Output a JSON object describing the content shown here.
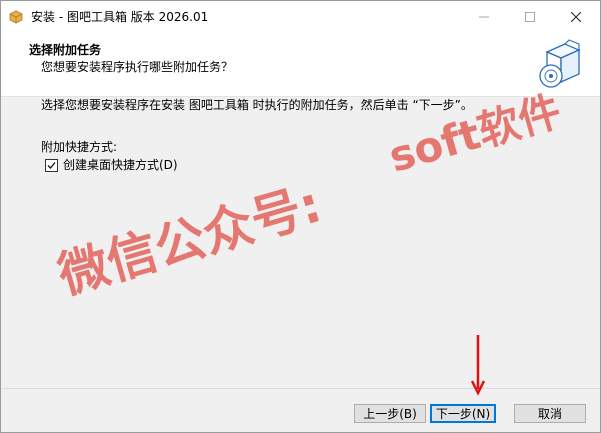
{
  "window": {
    "title": "安装 - 图吧工具箱 版本 2026.01"
  },
  "header": {
    "title": "选择附加任务",
    "subtitle": "您想要安装程序执行哪些附加任务？"
  },
  "main": {
    "description": "选择您想要安装程序在安装 图吧工具箱 时执行的附加任务，然后单击 “下一步”。",
    "group_label": "附加快捷方式:",
    "checkbox": {
      "label": "创建桌面快捷方式(D)",
      "checked": true
    }
  },
  "footer": {
    "back_label": "上一步(B)",
    "next_label": "下一步(N)",
    "cancel_label": "取消"
  },
  "watermark": {
    "line1": "soft软件",
    "line2": "微信公众号:"
  },
  "colors": {
    "accent_blue": "#0078d7",
    "watermark_red": "#e04840",
    "arrow_red": "#e01010"
  },
  "icons": [
    "app-icon",
    "minimize-icon",
    "maximize-icon",
    "close-icon",
    "install-box-icon",
    "checkmark-icon",
    "red-arrow-icon"
  ]
}
